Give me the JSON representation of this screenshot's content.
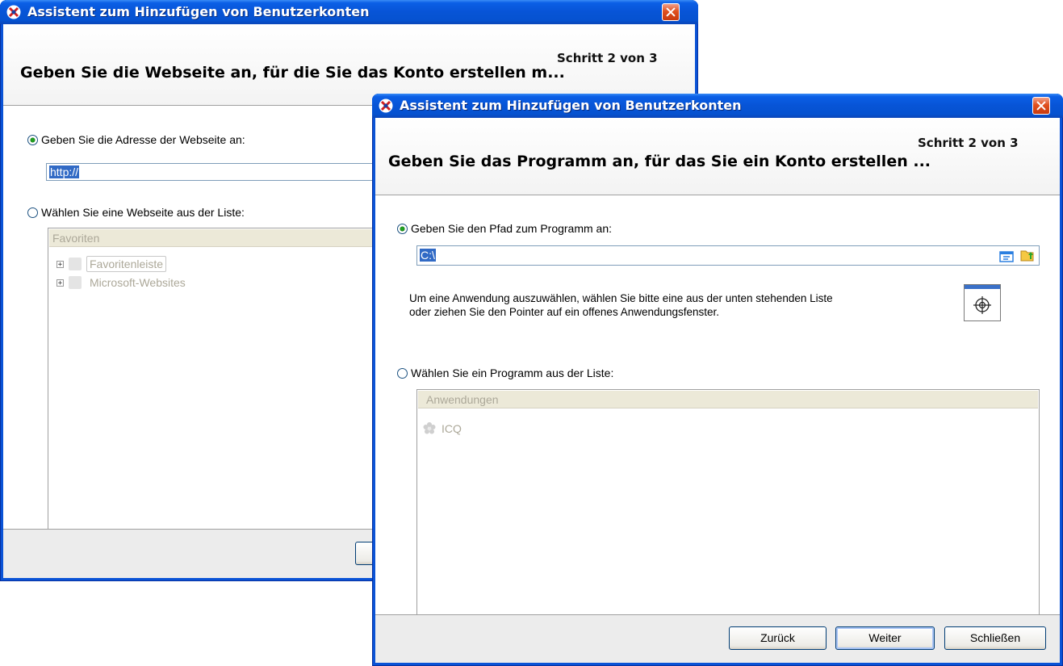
{
  "back_window": {
    "title": "Assistent zum Hinzufügen von Benutzerkonten",
    "step": "Schritt 2 von 3",
    "heading": "Geben Sie die Webseite an, für die Sie das Konto erstellen m...",
    "option_address_label": "Geben Sie die Adresse der Webseite an:",
    "address_value": "http://",
    "option_list_label": "Wählen Sie eine Webseite aus der Liste:",
    "list_header": "Favoriten",
    "tree_items": [
      "Favoritenleiste",
      "Microsoft-Websites"
    ],
    "expander_glyph": "+"
  },
  "front_window": {
    "title": "Assistent zum Hinzufügen von Benutzerkonten",
    "step": "Schritt 2 von 3",
    "heading": "Geben Sie das Programm an, für das Sie ein Konto erstellen ...",
    "option_path_label": "Geben Sie den Pfad zum Programm an:",
    "path_value": "C:\\",
    "info_line1": "Um eine Anwendung auszuwählen, wählen Sie bitte eine aus der unten stehenden Liste",
    "info_line2": "oder ziehen Sie den Pointer auf ein offenes Anwendungsfenster.",
    "option_list_label": "Wählen Sie ein Programm aus der Liste:",
    "list_header": "Anwendungen",
    "list_items": [
      "ICQ"
    ],
    "buttons": {
      "back": "Zurück",
      "next": "Weiter",
      "close": "Schließen"
    }
  },
  "colors": {
    "titlebar": "#0754d6",
    "selection": "#316ac5",
    "radio_dot": "#21a121",
    "close_button": "#e0501e"
  },
  "icons": [
    "app-logo-icon",
    "close-icon",
    "browse-icon",
    "folder-open-icon",
    "crosshair-target-icon",
    "icq-flower-icon",
    "folder-icon",
    "expand-plus-icon"
  ]
}
